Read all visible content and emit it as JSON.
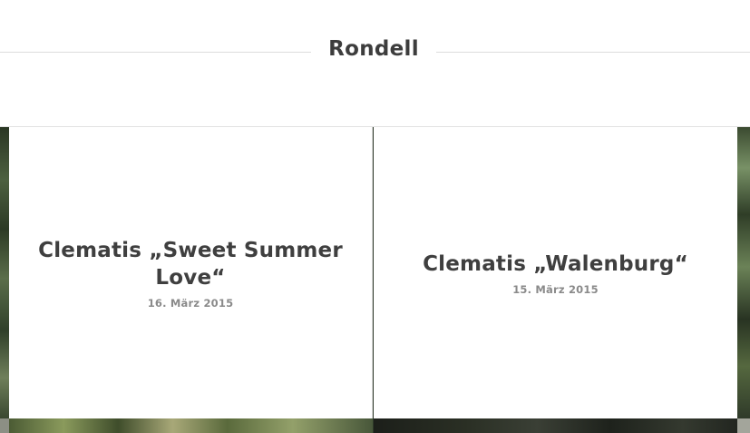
{
  "section": {
    "title": "Rondell"
  },
  "posts": [
    {
      "title": "Clematis „Sweet Summer Love“",
      "date": "16. März 2015"
    },
    {
      "title": "Clematis „Walenburg“",
      "date": "15. März 2015"
    }
  ]
}
